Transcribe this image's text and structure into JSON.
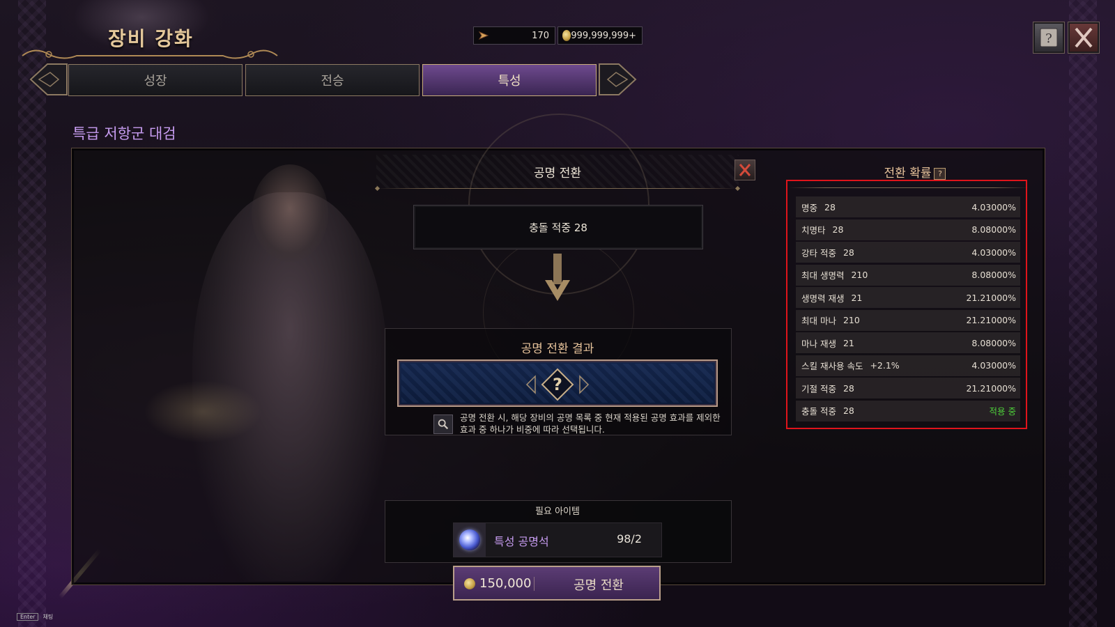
{
  "header": {
    "title": "장비 강화",
    "currency_1": {
      "icon": "ticket-icon",
      "value": "170"
    },
    "currency_2": {
      "icon": "gold-coin-icon",
      "value": "999,999,999+"
    }
  },
  "top_buttons": {
    "help": "help-book-icon",
    "close": "close-icon"
  },
  "tabs": [
    {
      "label": "성장",
      "active": false
    },
    {
      "label": "전승",
      "active": false
    },
    {
      "label": "특성",
      "active": true
    }
  ],
  "item_name": "특급 저항군 대검",
  "conversion": {
    "title": "공명 전환",
    "source_effect": "충돌 적중 28",
    "result_title": "공명 전환 결과",
    "result_placeholder": "?",
    "info_text": "공명 전환 시, 해당 장비의 공명 목록 중 현재 적용된 공명 효과를 제외한 효과 중 하나가 비중에 따라 선택됩니다.",
    "required_title": "필요 아이템",
    "required_item": {
      "name": "특성 공명석",
      "count": "98/2"
    },
    "cost": "150,000",
    "button_label": "공명 전환"
  },
  "probability": {
    "title": "전환 확률",
    "help": "?",
    "rows": [
      {
        "name": "명중",
        "value": "28",
        "chance": "4.03000%",
        "active": false
      },
      {
        "name": "치명타",
        "value": "28",
        "chance": "8.08000%",
        "active": false
      },
      {
        "name": "강타 적중",
        "value": "28",
        "chance": "4.03000%",
        "active": false
      },
      {
        "name": "최대 생명력",
        "value": "210",
        "chance": "8.08000%",
        "active": false
      },
      {
        "name": "생명력 재생",
        "value": "21",
        "chance": "21.21000%",
        "active": false
      },
      {
        "name": "최대 마나",
        "value": "210",
        "chance": "21.21000%",
        "active": false
      },
      {
        "name": "마나 재생",
        "value": "21",
        "chance": "8.08000%",
        "active": false
      },
      {
        "name": "스킬 재사용 속도",
        "value": "+2.1%",
        "chance": "4.03000%",
        "active": false
      },
      {
        "name": "기절 적중",
        "value": "28",
        "chance": "21.21000%",
        "active": false
      },
      {
        "name": "충돌 적중",
        "value": "28",
        "chance": "적용 중",
        "active": true
      }
    ]
  },
  "footer": {
    "enter_key": "Enter",
    "enter_label": "채팅"
  },
  "colors": {
    "accent_purple": "#c79cf0",
    "gold_text": "#e6c29a",
    "active_green": "#4ed03a",
    "highlight_red": "#e0141b"
  }
}
